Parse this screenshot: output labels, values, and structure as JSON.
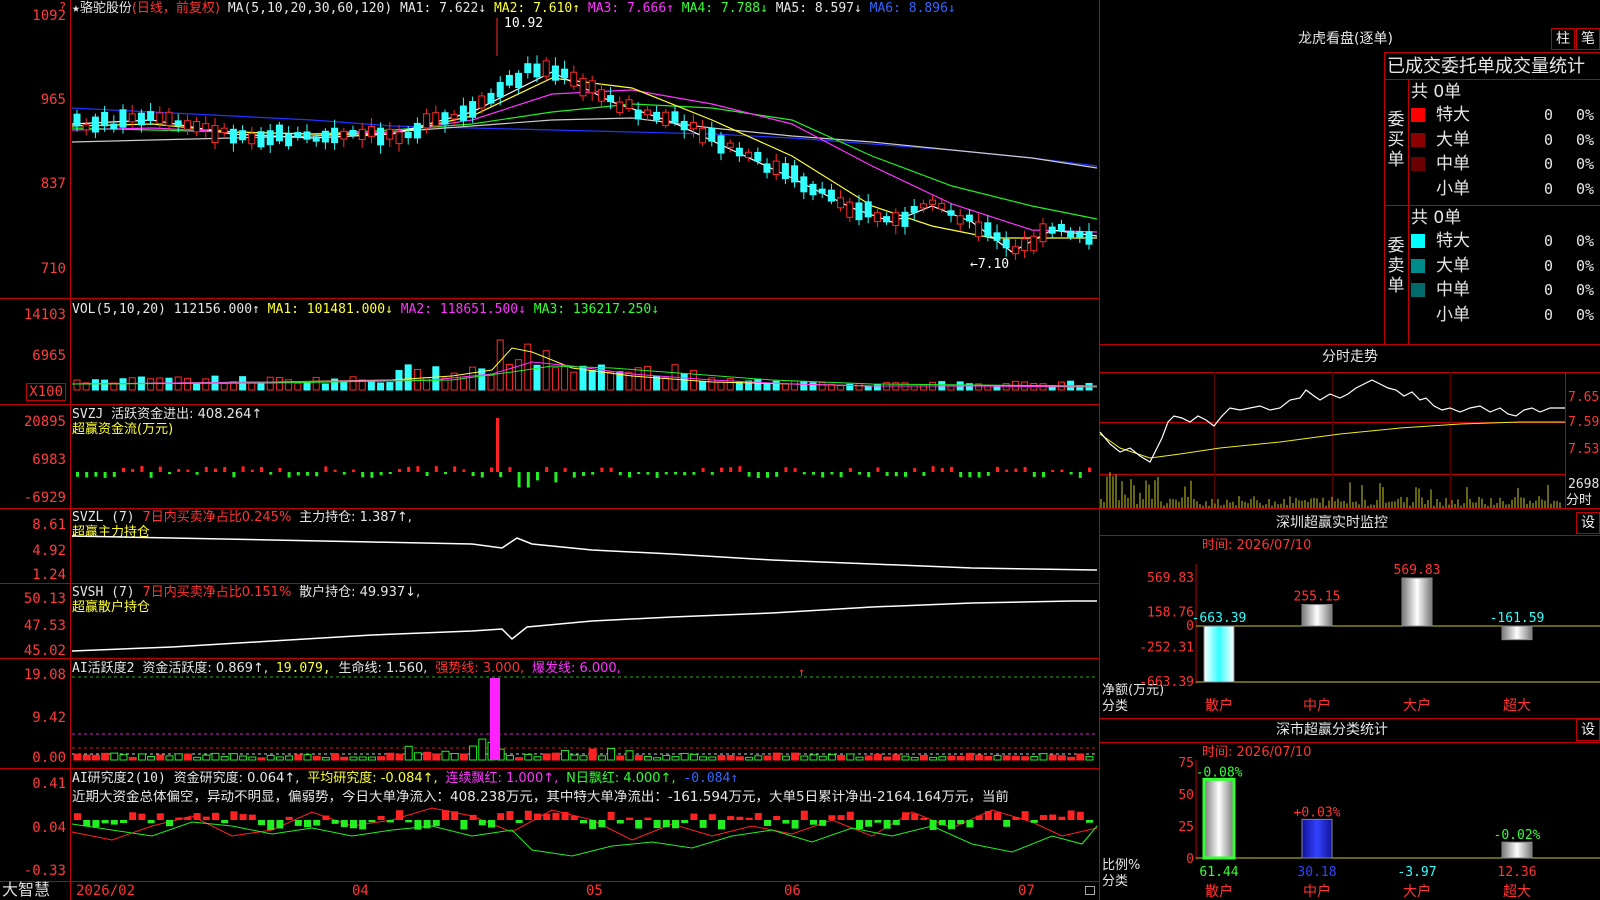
{
  "app": {
    "brand": "大智慧"
  },
  "header": {
    "star": "★",
    "stock_name": "骆驼股份",
    "mode": "(日线，前复权)",
    "ma_title": "MA(5,10,20,30,60,120)",
    "ma1": "MA1: 7.622↓",
    "ma2": "MA2: 7.610↑",
    "ma3": "MA3: 7.666↑",
    "ma4": "MA4: 7.788↓",
    "ma5": "MA5: 8.597↓",
    "ma6": "MA6: 8.896↓"
  },
  "price_axis": [
    "1092",
    "965",
    "837",
    "710"
  ],
  "price_marks": {
    "high": "10.92",
    "low": "←7.10"
  },
  "vol": {
    "title": "VOL(5,10,20)",
    "value": "112156.000↑",
    "ma1": "MA1: 101481.000↓",
    "ma2": "MA2: 118651.500↓",
    "ma3": "MA3: 136217.250↓",
    "axis": [
      "14103",
      "6965"
    ],
    "unit": "X100"
  },
  "svzj": {
    "title": "SVZJ",
    "line1": "活跃资金进出: 408.264↑",
    "line2": "超赢资金流(万元)",
    "axis": [
      "20895",
      "6983",
      "-6929"
    ]
  },
  "svzl": {
    "title": "SVZL (7)",
    "text1": "7日内买卖净占比0.245%",
    "text2": "主力持仓: 1.387↑,",
    "line2": "超赢主力持仓",
    "axis": [
      "8.61",
      "4.92",
      "1.24"
    ]
  },
  "svsh": {
    "title": "SVSH (7)",
    "text1": "7日内买卖净占比0.151%",
    "text2": "散户持仓: 49.937↓,",
    "line2": "超赢散户持仓",
    "axis": [
      "50.13",
      "47.53",
      "45.02"
    ]
  },
  "ai2": {
    "title": "AI活跃度2",
    "t1": "资金活跃度: 0.869↑,",
    "t2": "19.079,",
    "t3": "生命线: 1.560,",
    "t4": "强势线: 3.000,",
    "t5": "爆发线: 6.000,",
    "axis": [
      "19.08",
      "9.42",
      "0.00"
    ]
  },
  "ai_research": {
    "title": "AI研究度2(10)",
    "t1": "资金研究度: 0.064↑,",
    "t2": "平均研究度: -0.084↑,",
    "t3": "连续飘红: 1.000↑,",
    "t4": "N日飘红: 4.000↑,",
    "t5": "-0.084↑",
    "summary": "近期大资金总体偏空，异动不明显，偏弱势，今日大单净流入：408.238万元，其中特大单净流出：-161.594万元，大单5日累计净出-2164.164万元，当前",
    "axis": [
      "0.41",
      "0.04",
      "-0.33"
    ]
  },
  "date_axis": [
    "2026/02",
    "04",
    "05",
    "06",
    "07"
  ],
  "lhb": {
    "title": "龙虎看盘(逐单)",
    "btn1": "柱",
    "btn2": "笔",
    "subtitle": "已成交委托单成交量统计",
    "buy_label": "委买单",
    "sell_label": "委卖单",
    "buy_total": "共 0单",
    "sell_total": "共 0单",
    "buy_rows": [
      {
        "name": "特大",
        "count": "0",
        "pct": "0%"
      },
      {
        "name": "大单",
        "count": "0",
        "pct": "0%"
      },
      {
        "name": "中单",
        "count": "0",
        "pct": "0%"
      },
      {
        "name": "小单",
        "count": "0",
        "pct": "0%"
      }
    ],
    "sell_rows": [
      {
        "name": "特大",
        "count": "0",
        "pct": "0%"
      },
      {
        "name": "大单",
        "count": "0",
        "pct": "0%"
      },
      {
        "name": "中单",
        "count": "0",
        "pct": "0%"
      },
      {
        "name": "小单",
        "count": "0",
        "pct": "0%"
      }
    ],
    "buy_colors": [
      "#ff0000",
      "#8b0000",
      "#6b0000",
      "#000000"
    ],
    "sell_colors": [
      "#00ffff",
      "#008b8b",
      "#006b6b",
      "#000000"
    ]
  },
  "intraday": {
    "title": "分时走势",
    "axis": [
      "7.65",
      "7.59",
      "7.53"
    ],
    "vol_axis": "2698",
    "vol_label": "分时"
  },
  "monitor": {
    "title": "深圳超赢实时监控",
    "set": "设",
    "time": "时间: 2026/07/10",
    "axis": [
      "569.83",
      "158.76",
      "0",
      "-252.31",
      "-663.39"
    ],
    "ylabel": "净额(万元)",
    "xlabel": "分类",
    "categories": [
      "散户",
      "中户",
      "大户",
      "超大"
    ],
    "values": [
      -663.39,
      255.15,
      569.83,
      -161.59
    ],
    "value_labels": [
      "-663.39",
      "255.15",
      "569.83",
      "-161.59"
    ]
  },
  "classify": {
    "title": "深市超赢分类统计",
    "set": "设",
    "time": "时间: 2026/07/10",
    "axis": [
      "75",
      "50",
      "25",
      "0"
    ],
    "ylabel": "比例%",
    "xlabel": "分类",
    "categories": [
      "散户",
      "中户",
      "大户",
      "超大"
    ],
    "values": [
      61.44,
      30.18,
      -3.97,
      12.36
    ],
    "value_labels": [
      "61.44",
      "30.18",
      "-3.97",
      "12.36"
    ],
    "change_labels": [
      "-0.08%",
      "+0.03%",
      "",
      "-0.02%"
    ]
  },
  "chart_data": [
    {
      "type": "bar",
      "title": "深圳超赢实时监控",
      "categories": [
        "散户",
        "中户",
        "大户",
        "超大"
      ],
      "values": [
        -663.39,
        255.15,
        569.83,
        -161.59
      ],
      "ylabel": "净额(万元)",
      "xlabel": "分类",
      "ylim": [
        -663.39,
        569.83
      ]
    },
    {
      "type": "bar",
      "title": "深市超赢分类统计",
      "categories": [
        "散户",
        "中户",
        "大户",
        "超大"
      ],
      "values": [
        61.44,
        30.18,
        -3.97,
        12.36
      ],
      "ylabel": "比例%",
      "xlabel": "分类",
      "ylim": [
        0,
        75
      ]
    }
  ]
}
